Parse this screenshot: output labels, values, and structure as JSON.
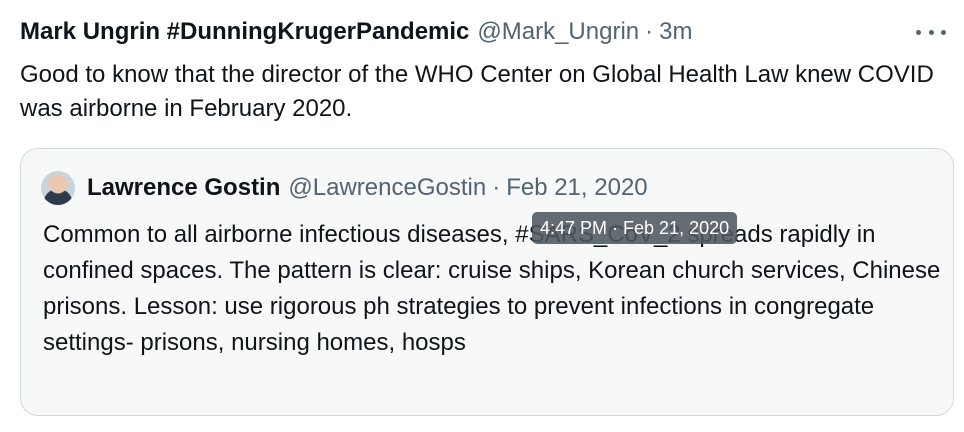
{
  "tweet": {
    "author_name": "Mark Ungrin #DunningKrugerPandemic",
    "author_handle": "@Mark_Ungrin",
    "separator": "·",
    "time": "3m",
    "text": "Good to know that the director of the WHO Center on Global Health Law knew COVID was airborne in February 2020."
  },
  "quote": {
    "author_name": "Lawrence Gostin",
    "author_handle": "@LawrenceGostin",
    "separator": "·",
    "date": "Feb 21, 2020",
    "text": "Common to all airborne infectious diseases, #SARS_CoV_2 spreads rapidly in confined spaces. The pattern is clear: cruise ships, Korean church services, Chinese prisons. Lesson: use rigorous ph strategies to prevent infections in congregate settings- prisons, nursing homes, hosps"
  },
  "tooltip": {
    "text": "4:47 PM · Feb 21, 2020"
  },
  "colors": {
    "text": "#0f1419",
    "secondary": "#536471",
    "quote_border": "#cfd9de",
    "quote_background": "#f7f9f9"
  },
  "icons": {
    "more": "more-horizontal-icon",
    "avatar": "avatar"
  }
}
